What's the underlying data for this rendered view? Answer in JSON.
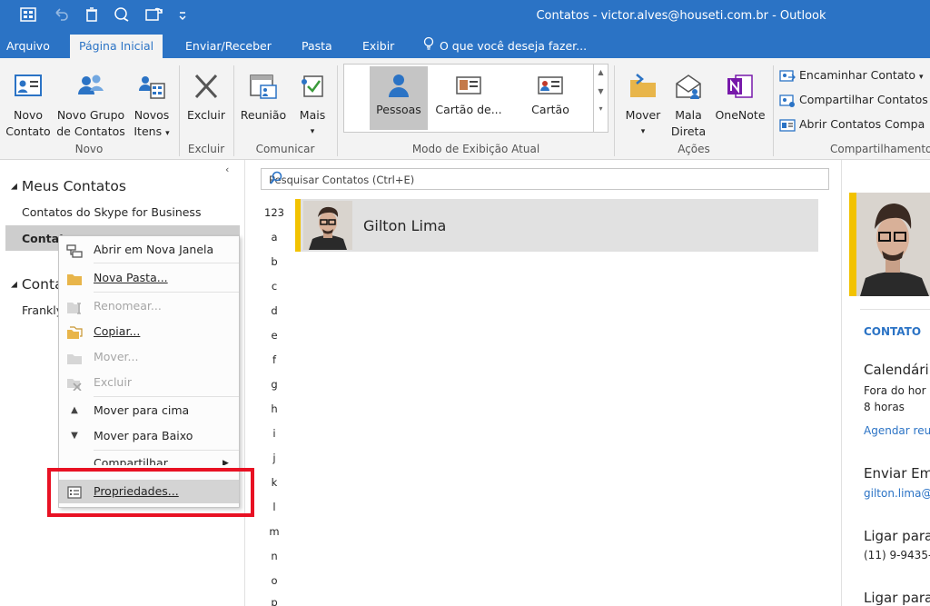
{
  "window": {
    "title": "Contatos - victor.alves@houseti.com.br - Outlook"
  },
  "tabs": [
    {
      "label": "Arquivo"
    },
    {
      "label": "Página Inicial"
    },
    {
      "label": "Enviar/Receber"
    },
    {
      "label": "Pasta"
    },
    {
      "label": "Exibir"
    },
    {
      "label": "O que você deseja fazer..."
    }
  ],
  "ribbon": {
    "novo_contato": [
      "Novo",
      "Contato"
    ],
    "novo_grupo": [
      "Novo Grupo",
      "de Contatos"
    ],
    "novos_itens": [
      "Novos",
      "Itens"
    ],
    "excluir": "Excluir",
    "reuniao": "Reunião",
    "mais": "Mais",
    "views": [
      "Pessoas",
      "Cartão de...",
      "Cartão"
    ],
    "mover": "Mover",
    "mala_direta": [
      "Mala",
      "Direta"
    ],
    "onenote": "OneNote",
    "share_items": [
      "Encaminhar Contato",
      "Compartilhar Contatos",
      "Abrir Contatos Compa"
    ],
    "groups": [
      "Novo",
      "Excluir",
      "Comunicar",
      "Modo de Exibição Atual",
      "Ações",
      "Compartilhamento"
    ]
  },
  "nav": {
    "meus_contatos": "Meus Contatos",
    "skype": "Contatos do Skype for Business",
    "contatos_sel": "Contat",
    "contatos2": "Conta",
    "frankly": "Frankly"
  },
  "context_menu": [
    {
      "label": "Abrir em Nova Janela",
      "disabled": false
    },
    {
      "label": "Nova Pasta...",
      "disabled": false
    },
    {
      "label": "Renomear...",
      "disabled": true
    },
    {
      "label": "Copiar...",
      "disabled": false
    },
    {
      "label": "Mover...",
      "disabled": true
    },
    {
      "label": "Excluir",
      "disabled": true
    },
    {
      "label": "Mover para cima",
      "disabled": false
    },
    {
      "label": "Mover para Baixo",
      "disabled": false
    },
    {
      "label": "Compartilhar",
      "disabled": false
    },
    {
      "label": "Propriedades...",
      "disabled": false
    }
  ],
  "search": {
    "placeholder": "Pesquisar Contatos (Ctrl+E)"
  },
  "alphabet": [
    "123",
    "a",
    "b",
    "c",
    "d",
    "e",
    "f",
    "g",
    "h",
    "i",
    "j",
    "k",
    "l",
    "m",
    "n",
    "o",
    "p"
  ],
  "contact": {
    "name": "Gilton Lima"
  },
  "right_pane": {
    "section": "CONTATO",
    "calendar": "Calendári",
    "fora": "Fora do hor",
    "horas": "8 horas",
    "agendar": "Agendar reu",
    "enviar": "Enviar Em",
    "email": "gilton.lima@",
    "ligar1": "Ligar para",
    "phone": "(11) 9-9435-",
    "ligar2": "Ligar para"
  },
  "colors": {
    "accent": "#2b73c5",
    "highlight": "#e81123",
    "card_bar": "#f2c200"
  }
}
